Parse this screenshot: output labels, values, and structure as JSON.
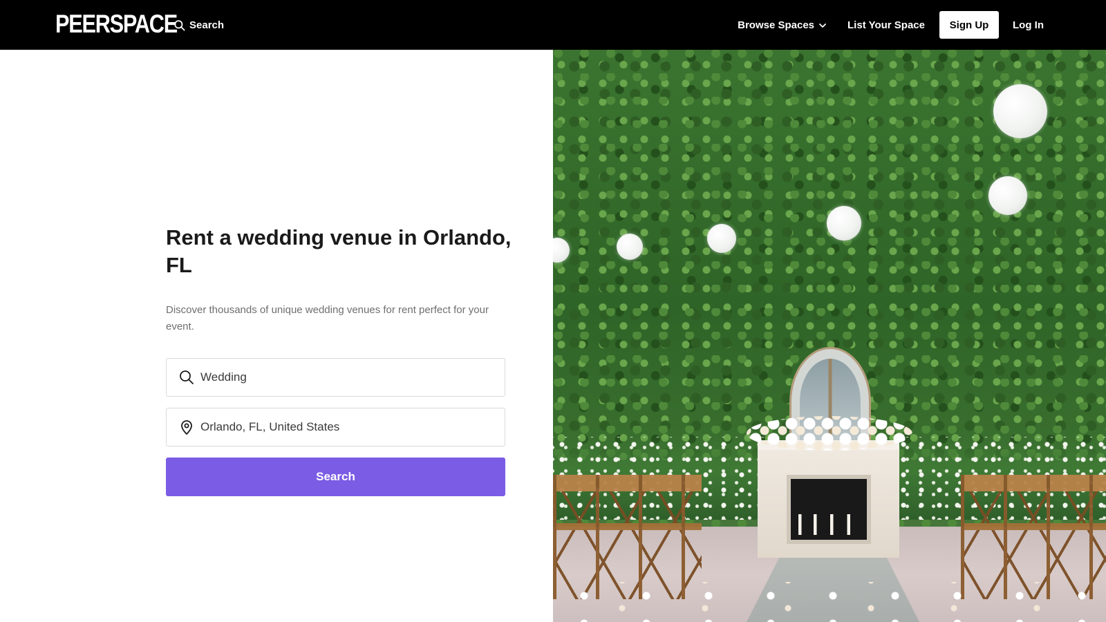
{
  "header": {
    "logo_text": "PEERSPACE",
    "search_label": "Search",
    "browse_label": "Browse Spaces",
    "list_label": "List Your Space",
    "signup_label": "Sign Up",
    "login_label": "Log In"
  },
  "hero": {
    "title": "Rent a wedding venue in Orlando, FL",
    "subtitle": "Discover thousands of unique wedding venues for rent perfect for your event.",
    "activity_value": "Wedding",
    "location_value": "Orlando, FL, United States",
    "search_button_label": "Search",
    "image_description": "Outdoor wedding ceremony with ivy wall, paper lanterns, fireplace and wooden chairs"
  },
  "icons": {
    "nav_search": "search-icon",
    "browse_chevron": "chevron-down-icon",
    "activity": "search-icon",
    "location": "map-pin-icon"
  },
  "colors": {
    "header_bg": "#000000",
    "primary_button": "#7b5ce5",
    "title_text": "#1a1a1a",
    "subtitle_text": "#6e6e6e",
    "field_border": "#d9d9d9"
  }
}
